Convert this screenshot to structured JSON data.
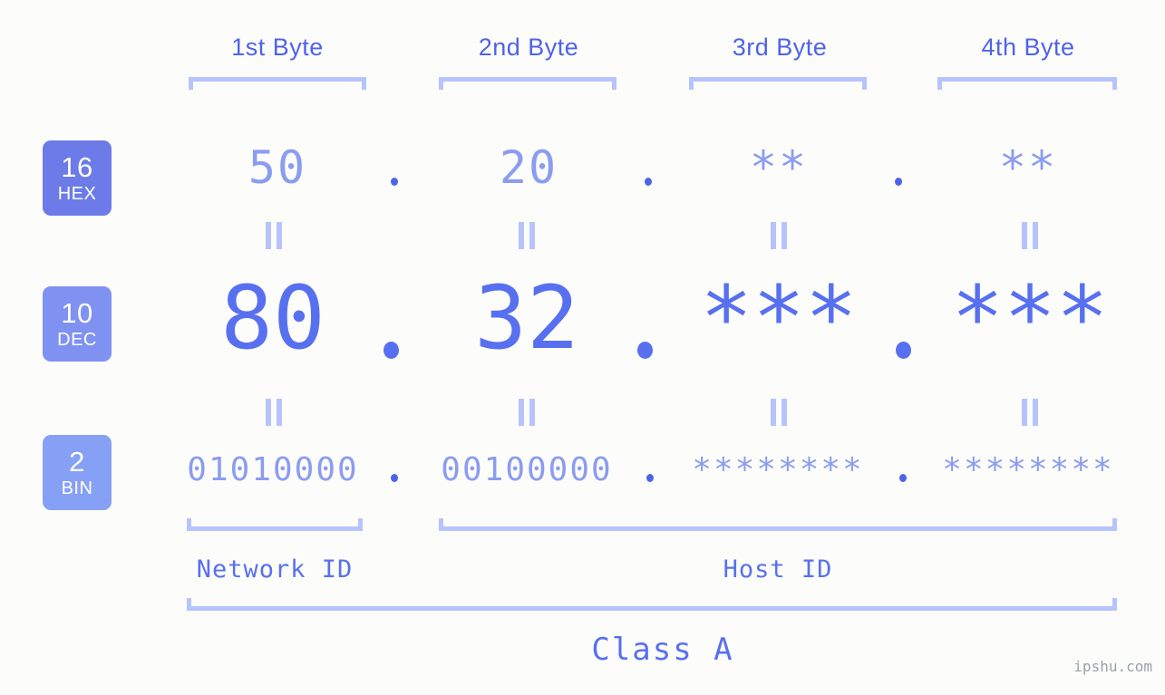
{
  "background_color": "#fcfdfa",
  "accent_colors": {
    "badge_hex": "#6c7be8",
    "badge_dec": "#7f92f2",
    "badge_bin": "#86a0f5",
    "text_strong": "#4f63e8",
    "text_dec": "#5870f0",
    "text_light": "#8b9cf1",
    "bracket": "#b7c3fd"
  },
  "byte_headers": [
    {
      "label": "1st Byte"
    },
    {
      "label": "2nd Byte"
    },
    {
      "label": "3rd Byte"
    },
    {
      "label": "4th Byte"
    }
  ],
  "rows": [
    {
      "badge_number": "16",
      "badge_abbr": "HEX",
      "values": [
        "50",
        "20",
        "**",
        "**"
      ],
      "separator": "."
    },
    {
      "badge_number": "10",
      "badge_abbr": "DEC",
      "values": [
        "80",
        "32",
        "***",
        "***"
      ],
      "separator": "."
    },
    {
      "badge_number": "2",
      "badge_abbr": "BIN",
      "values": [
        "01010000",
        "00100000",
        "********",
        "********"
      ],
      "separator": "."
    }
  ],
  "equality_symbol": "=",
  "segments": [
    {
      "label": "Network ID"
    },
    {
      "label": "Host ID"
    }
  ],
  "class_label": "Class A",
  "watermark": "ipshu.com"
}
